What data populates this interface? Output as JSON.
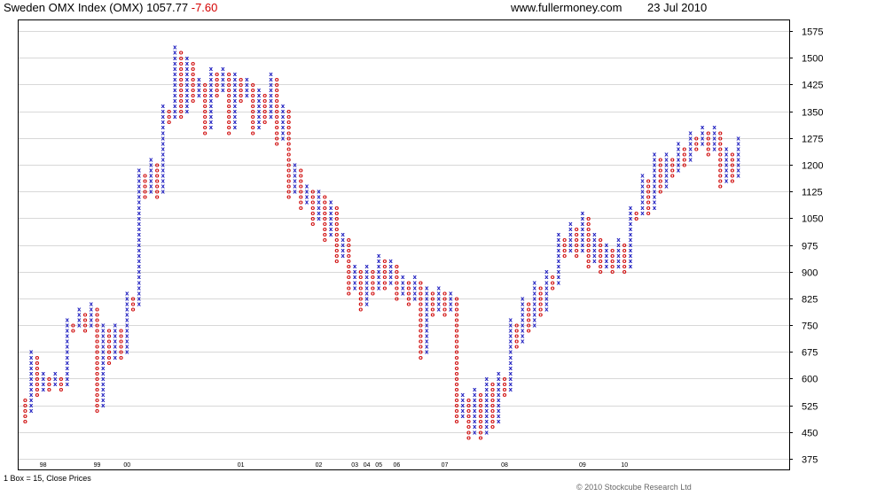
{
  "header": {
    "index_name": "Sweden OMX Index (OMX)",
    "last": "1057.77",
    "change": "-7.60",
    "site": "www.fullermoney.com",
    "date": "23 Jul 2010"
  },
  "footer": {
    "box_info": "1 Box = 15, Close Prices",
    "copyright": "© 2010 Stockcube Research Ltd"
  },
  "chart_data": {
    "type": "point-and-figure",
    "box_size": 15,
    "reversal": 3,
    "ylim": [
      345,
      1605
    ],
    "y_ticks": [
      375,
      450,
      525,
      600,
      675,
      750,
      825,
      900,
      975,
      1050,
      1125,
      1200,
      1275,
      1350,
      1425,
      1500,
      1575
    ],
    "year_labels": [
      {
        "label": "98",
        "col": 3
      },
      {
        "label": "99",
        "col": 12
      },
      {
        "label": "00",
        "col": 17
      },
      {
        "label": "01",
        "col": 36
      },
      {
        "label": "02",
        "col": 49
      },
      {
        "label": "03",
        "col": 55
      },
      {
        "label": "04",
        "col": 57
      },
      {
        "label": "05",
        "col": 59
      },
      {
        "label": "06",
        "col": 62
      },
      {
        "label": "07",
        "col": 70
      },
      {
        "label": "08",
        "col": 80
      },
      {
        "label": "09",
        "col": 93
      },
      {
        "label": "10",
        "col": 100
      }
    ],
    "x_symbol_color": "#2020c0",
    "o_symbol_color": "#d01010",
    "grid": "horizontal",
    "columns": [
      [
        "O",
        540,
        480
      ],
      [
        "X",
        510,
        675
      ],
      [
        "O",
        660,
        555
      ],
      [
        "X",
        570,
        615
      ],
      [
        "O",
        600,
        570
      ],
      [
        "X",
        585,
        615
      ],
      [
        "O",
        600,
        570
      ],
      [
        "X",
        585,
        765
      ],
      [
        "O",
        750,
        735
      ],
      [
        "X",
        750,
        795
      ],
      [
        "O",
        780,
        735
      ],
      [
        "X",
        750,
        810
      ],
      [
        "O",
        795,
        510
      ],
      [
        "X",
        525,
        750
      ],
      [
        "O",
        735,
        645
      ],
      [
        "X",
        660,
        750
      ],
      [
        "O",
        735,
        660
      ],
      [
        "X",
        675,
        840
      ],
      [
        "O",
        825,
        795
      ],
      [
        "X",
        810,
        1185
      ],
      [
        "O",
        1170,
        1110
      ],
      [
        "X",
        1125,
        1215
      ],
      [
        "O",
        1200,
        1110
      ],
      [
        "X",
        1125,
        1365
      ],
      [
        "O",
        1350,
        1320
      ],
      [
        "X",
        1335,
        1530
      ],
      [
        "O",
        1515,
        1335
      ],
      [
        "X",
        1350,
        1500
      ],
      [
        "O",
        1485,
        1380
      ],
      [
        "X",
        1395,
        1440
      ],
      [
        "O",
        1425,
        1290
      ],
      [
        "X",
        1305,
        1470
      ],
      [
        "O",
        1455,
        1395
      ],
      [
        "X",
        1410,
        1470
      ],
      [
        "O",
        1455,
        1290
      ],
      [
        "X",
        1305,
        1455
      ],
      [
        "O",
        1440,
        1380
      ],
      [
        "X",
        1395,
        1440
      ],
      [
        "O",
        1425,
        1290
      ],
      [
        "X",
        1305,
        1410
      ],
      [
        "O",
        1395,
        1320
      ],
      [
        "X",
        1335,
        1455
      ],
      [
        "O",
        1440,
        1260
      ],
      [
        "X",
        1275,
        1365
      ],
      [
        "O",
        1350,
        1110
      ],
      [
        "X",
        1125,
        1200
      ],
      [
        "O",
        1185,
        1080
      ],
      [
        "X",
        1095,
        1140
      ],
      [
        "O",
        1125,
        1035
      ],
      [
        "X",
        1050,
        1125
      ],
      [
        "O",
        1110,
        990
      ],
      [
        "X",
        1005,
        1095
      ],
      [
        "O",
        1080,
        930
      ],
      [
        "X",
        945,
        1005
      ],
      [
        "O",
        990,
        840
      ],
      [
        "X",
        855,
        915
      ],
      [
        "O",
        900,
        795
      ],
      [
        "X",
        810,
        915
      ],
      [
        "O",
        900,
        840
      ],
      [
        "X",
        855,
        945
      ],
      [
        "O",
        930,
        855
      ],
      [
        "X",
        870,
        930
      ],
      [
        "O",
        915,
        825
      ],
      [
        "X",
        840,
        885
      ],
      [
        "O",
        870,
        810
      ],
      [
        "X",
        825,
        885
      ],
      [
        "O",
        870,
        660
      ],
      [
        "X",
        675,
        855
      ],
      [
        "O",
        840,
        780
      ],
      [
        "X",
        795,
        855
      ],
      [
        "O",
        840,
        780
      ],
      [
        "X",
        795,
        840
      ],
      [
        "O",
        825,
        480
      ],
      [
        "X",
        495,
        555
      ],
      [
        "O",
        540,
        435
      ],
      [
        "X",
        450,
        570
      ],
      [
        "O",
        555,
        435
      ],
      [
        "X",
        450,
        600
      ],
      [
        "O",
        585,
        465
      ],
      [
        "X",
        480,
        615
      ],
      [
        "O",
        600,
        555
      ],
      [
        "X",
        570,
        765
      ],
      [
        "O",
        750,
        690
      ],
      [
        "X",
        705,
        825
      ],
      [
        "O",
        810,
        735
      ],
      [
        "X",
        750,
        870
      ],
      [
        "O",
        855,
        780
      ],
      [
        "X",
        795,
        900
      ],
      [
        "O",
        885,
        855
      ],
      [
        "X",
        870,
        1005
      ],
      [
        "O",
        990,
        945
      ],
      [
        "X",
        960,
        1035
      ],
      [
        "O",
        1020,
        945
      ],
      [
        "X",
        960,
        1065
      ],
      [
        "O",
        1050,
        915
      ],
      [
        "X",
        930,
        1005
      ],
      [
        "O",
        990,
        900
      ],
      [
        "X",
        915,
        975
      ],
      [
        "O",
        960,
        900
      ],
      [
        "X",
        915,
        990
      ],
      [
        "O",
        975,
        900
      ],
      [
        "X",
        915,
        1080
      ],
      [
        "O",
        1065,
        1050
      ],
      [
        "X",
        1065,
        1170
      ],
      [
        "O",
        1155,
        1065
      ],
      [
        "X",
        1080,
        1230
      ],
      [
        "O",
        1215,
        1125
      ],
      [
        "X",
        1140,
        1230
      ],
      [
        "O",
        1215,
        1170
      ],
      [
        "X",
        1185,
        1260
      ],
      [
        "O",
        1245,
        1200
      ],
      [
        "X",
        1215,
        1290
      ],
      [
        "O",
        1275,
        1245
      ],
      [
        "X",
        1260,
        1305
      ],
      [
        "O",
        1290,
        1230
      ],
      [
        "X",
        1245,
        1305
      ],
      [
        "O",
        1290,
        1140
      ],
      [
        "X",
        1155,
        1245
      ],
      [
        "O",
        1230,
        1155
      ],
      [
        "X",
        1170,
        1275
      ]
    ]
  }
}
